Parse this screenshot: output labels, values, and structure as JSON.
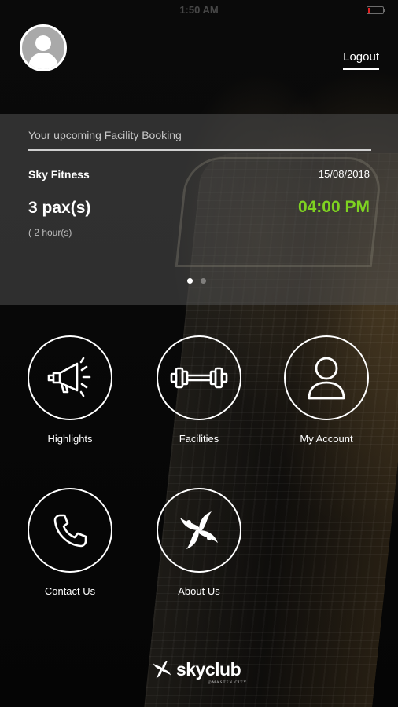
{
  "status_bar": {
    "time": "1:50 AM"
  },
  "header": {
    "logout_label": "Logout"
  },
  "booking": {
    "heading": "Your upcoming Facility Booking",
    "facility": "Sky Fitness",
    "date": "15/08/2018",
    "pax": "3 pax(s)",
    "time": "04:00 PM",
    "duration": "( 2 hour(s)",
    "pages": 2,
    "active_page": 1
  },
  "menu": {
    "items": [
      {
        "label": "Highlights",
        "icon": "megaphone-icon"
      },
      {
        "label": "Facilities",
        "icon": "dumbbell-icon"
      },
      {
        "label": "My Account",
        "icon": "person-icon"
      },
      {
        "label": "Contact Us",
        "icon": "phone-icon"
      },
      {
        "label": "About Us",
        "icon": "skyclub-emblem-icon"
      }
    ]
  },
  "footer": {
    "logo_text": "skyclub",
    "logo_subtext": "@MASTEN CITY"
  },
  "colors": {
    "accent_time": "#7ed321",
    "card_bg": "rgba(80,80,80,0.55)",
    "background": "#000000"
  }
}
